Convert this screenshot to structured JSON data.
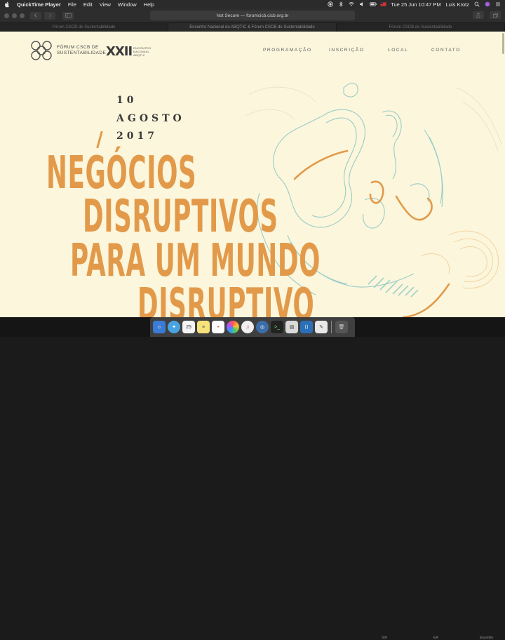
{
  "menubar": {
    "app_name": "QuickTime Player",
    "items": [
      "File",
      "Edit",
      "View",
      "Window",
      "Help"
    ],
    "clock": "Tue 25 Jun  10:47 PM",
    "user": "Luis Krotz"
  },
  "browser": {
    "address": "Not Secure — forumcicb.cicb.org.br",
    "tabs": [
      "Fórum CSCB de Sustentabilidade",
      "Encontro Nacional da ABQTIC & Fórum CSCB de Sustentabilidade",
      "Fórum CSCB de Sustentabilidade"
    ],
    "active_tab": 1
  },
  "site": {
    "logo_line1": "FÓRUM CSCB DE",
    "logo_line2": "SUSTENTABILIDADE",
    "event_numeral": "XXII",
    "event_line1": "ENCONTRO",
    "event_line2": "NACIONAL",
    "event_line3": "ABQTIC",
    "nav": {
      "programacao": "PROGRAMAÇÃO",
      "inscricao": "INSCRIÇÃO",
      "local": "LOCAL",
      "contato": "CONTATO"
    },
    "date_day": "10",
    "date_month": "AGOSTO",
    "date_year": "2017",
    "headline": [
      "NEGÓCIOS",
      "DISRUPTIVOS",
      "PARA UM MUNDO",
      "DISRUPTIVO"
    ],
    "accent_color": "#e29a4a",
    "line_color": "#8fc9c4"
  },
  "dock": {
    "calendar_day": "25",
    "background_labels": [
      "SW",
      "EA",
      "Etuveitte"
    ]
  }
}
